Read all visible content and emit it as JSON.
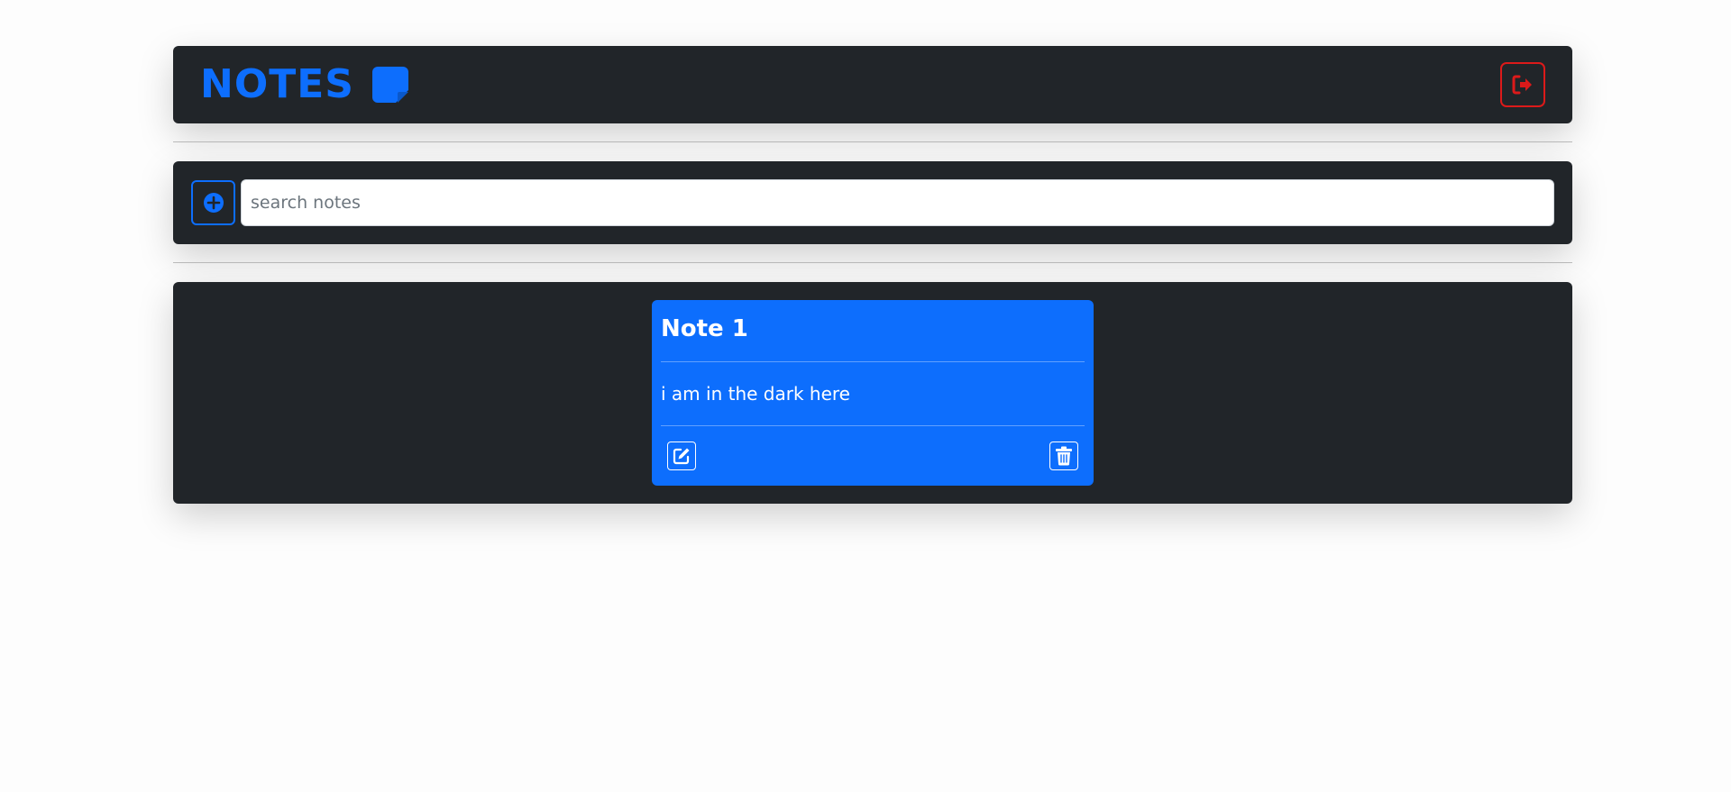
{
  "header": {
    "title": "NOTES",
    "icon": "sticky-note-icon",
    "logout_icon": "sign-out-icon"
  },
  "toolbar": {
    "add_icon": "plus-circle-icon",
    "search_placeholder": "search notes",
    "search_value": ""
  },
  "notes": [
    {
      "title": "Note 1",
      "body": "i am in the dark here",
      "edit_icon": "edit-icon",
      "delete_icon": "trash-icon"
    }
  ],
  "colors": {
    "accent": "#0d6efd",
    "panel": "#212529",
    "danger": "#dc1a1a",
    "page_bg": "#fdfdfd"
  }
}
